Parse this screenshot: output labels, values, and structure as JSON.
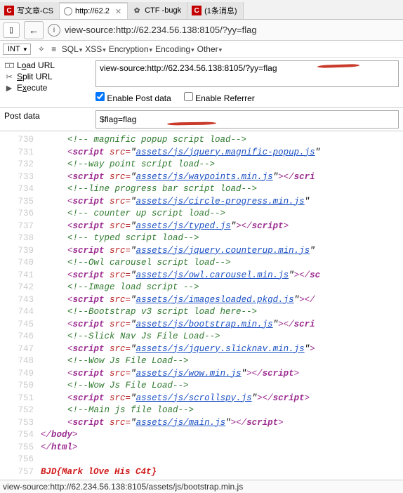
{
  "tabs": [
    {
      "title": "写文章-CS",
      "fav": "C"
    },
    {
      "title": "http://62.2",
      "fav": "globe",
      "active": true
    },
    {
      "title": "CTF -bugk",
      "fav": "gear"
    },
    {
      "title": "(1条消息)",
      "fav": "C"
    }
  ],
  "addressbar": "view-source:http://62.234.56.138:8105/?yy=flag",
  "int_label": "INT",
  "toolbar": {
    "sql": "SQL",
    "xss": "XSS",
    "enc": "Encryption",
    "encoding": "Encoding",
    "other": "Other"
  },
  "left": {
    "load": {
      "pre": "L",
      "u": "o",
      "post": "ad URL"
    },
    "split": {
      "pre": "",
      "u": "S",
      "post": "plit URL"
    },
    "exec": {
      "pre": "E",
      "u": "x",
      "post": "ecute"
    }
  },
  "url_field": "view-source:http://62.234.56.138:8105/?yy=flag",
  "enable_post": "Enable Post data",
  "enable_ref": "Enable Referrer",
  "post_label": "Post data",
  "post_value": "$flag=flag",
  "src": {
    "l730": {
      "n": "730",
      "c": "<!-- magnific popup script load-->"
    },
    "l731": {
      "n": "731",
      "u": "assets/js/jquery.magnific-popup.js"
    },
    "l732": {
      "n": "732",
      "c": "<!--way point script load-->"
    },
    "l733": {
      "n": "733",
      "u": "assets/js/waypoints.min.js"
    },
    "l734": {
      "n": "734",
      "c": "<!--line progress bar script load-->"
    },
    "l735": {
      "n": "735",
      "u": "assets/js/circle-progress.min.js"
    },
    "l736": {
      "n": "736",
      "c": "<!-- counter up script load-->"
    },
    "l737": {
      "n": "737",
      "u": "assets/js/typed.js"
    },
    "l738": {
      "n": "738",
      "c": "<!-- typed script load-->"
    },
    "l739": {
      "n": "739",
      "u": "assets/js/jquery.counterup.min.js"
    },
    "l740": {
      "n": "740",
      "c": "<!--Owl carousel script load-->"
    },
    "l741": {
      "n": "741",
      "u": "assets/js/owl.carousel.min.js"
    },
    "l742": {
      "n": "742",
      "c": "<!--Image load script -->"
    },
    "l743": {
      "n": "743",
      "u": "assets/js/imagesloaded.pkgd.js"
    },
    "l744": {
      "n": "744",
      "c": "<!--Bootstrap v3 script load here-->"
    },
    "l745": {
      "n": "745",
      "u": "assets/js/bootstrap.min.js"
    },
    "l746": {
      "n": "746",
      "c": "<!--Slick Nav Js File Load-->"
    },
    "l747": {
      "n": "747",
      "u": "assets/js/jquery.slicknav.min.js"
    },
    "l748": {
      "n": "748",
      "c": "<!--Wow Js File Load-->"
    },
    "l749": {
      "n": "749",
      "u": "assets/js/wow.min.js"
    },
    "l750": {
      "n": "750",
      "c": "<!--Wow Js File Load-->"
    },
    "l751": {
      "n": "751",
      "u": "assets/js/scrollspy.js"
    },
    "l752": {
      "n": "752",
      "c": "<!--Main js file load-->"
    },
    "l753": {
      "n": "753",
      "u": "assets/js/main.js"
    },
    "l754": {
      "n": "754",
      "t": "body"
    },
    "l755": {
      "n": "755",
      "t": "html"
    },
    "l756": {
      "n": "756"
    },
    "l757": {
      "n": "757",
      "flag": "BJD{Mark lOve His C4t}"
    }
  },
  "tag_open": "script",
  "tag_close": "script",
  "src_attr": "src=",
  "angle_open": "<",
  "angle_close": ">",
  "angle_end": "</",
  "status": "view-source:http://62.234.56.138:8105/assets/js/bootstrap.min.js"
}
